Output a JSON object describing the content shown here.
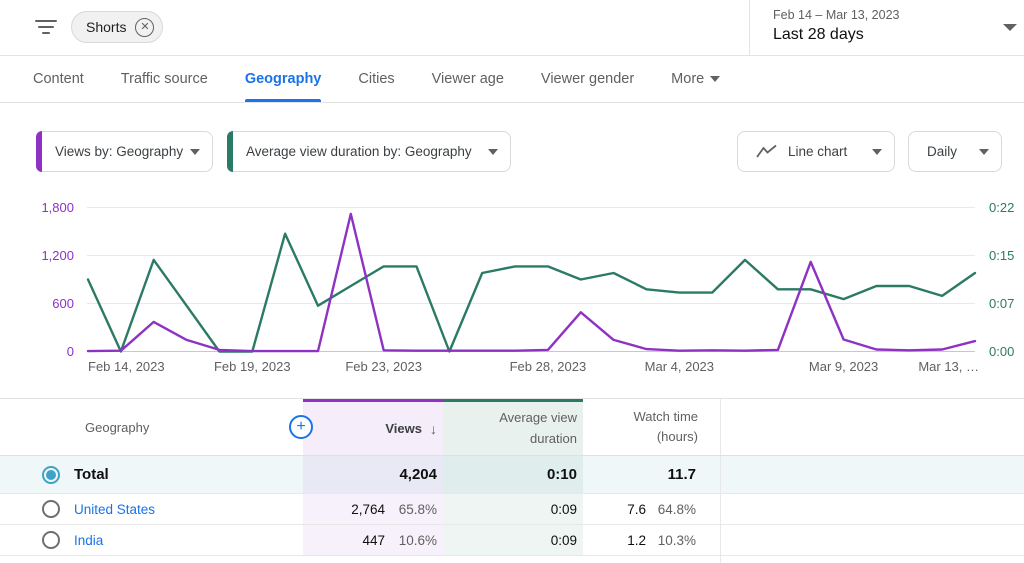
{
  "header": {
    "chip_label": "Shorts",
    "date_range": "Feb 14 – Mar 13, 2023",
    "date_preset": "Last 28 days"
  },
  "tabs": [
    {
      "label": "Content"
    },
    {
      "label": "Traffic source"
    },
    {
      "label": "Geography",
      "active": true
    },
    {
      "label": "Cities"
    },
    {
      "label": "Viewer age"
    },
    {
      "label": "Viewer gender"
    },
    {
      "label": "More"
    }
  ],
  "controls": {
    "metric1": "Views by: Geography",
    "metric2": "Average view duration by: Geography",
    "chart_type": "Line chart",
    "granularity": "Daily"
  },
  "chart_data": {
    "type": "line",
    "x": [
      "Feb 14",
      "Feb 15",
      "Feb 16",
      "Feb 17",
      "Feb 18",
      "Feb 19",
      "Feb 20",
      "Feb 21",
      "Feb 22",
      "Feb 23",
      "Feb 24",
      "Feb 25",
      "Feb 26",
      "Feb 27",
      "Feb 28",
      "Mar 1",
      "Mar 2",
      "Mar 3",
      "Mar 4",
      "Mar 5",
      "Mar 6",
      "Mar 7",
      "Mar 8",
      "Mar 9",
      "Mar 10",
      "Mar 11",
      "Mar 12",
      "Mar 13"
    ],
    "series": [
      {
        "name": "Views",
        "axis": "left",
        "color": "#8e32c4",
        "values": [
          5,
          10,
          370,
          145,
          20,
          5,
          5,
          5,
          1720,
          15,
          10,
          10,
          10,
          10,
          20,
          490,
          145,
          30,
          10,
          15,
          10,
          20,
          1120,
          150,
          25,
          15,
          25,
          130
        ]
      },
      {
        "name": "Average view duration (seconds)",
        "axis": "right",
        "color": "#2b7a66",
        "values": [
          11,
          0,
          14,
          7,
          0,
          0,
          18,
          7,
          10,
          13,
          13,
          0,
          12,
          13,
          13,
          11,
          12,
          9.5,
          9,
          9,
          14,
          9.5,
          9.5,
          8,
          10,
          10,
          8.5,
          12
        ]
      }
    ],
    "axes": {
      "left": {
        "title": "Views",
        "labels": [
          "0",
          "600",
          "1,200",
          "1,800"
        ],
        "max": 1800,
        "color": "#8e32c4"
      },
      "right": {
        "title": "Average view duration",
        "labels": [
          "0:00",
          "0:07",
          "0:15",
          "0:22"
        ],
        "max_seconds": 22,
        "color": "#2b7a66"
      }
    },
    "x_ticks": [
      {
        "day": 0,
        "label": "Feb 14, 2023"
      },
      {
        "day": 5,
        "label": "Feb 19, 2023"
      },
      {
        "day": 9,
        "label": "Feb 23, 2023"
      },
      {
        "day": 14,
        "label": "Feb 28, 2023"
      },
      {
        "day": 18,
        "label": "Mar 4, 2023"
      },
      {
        "day": 23,
        "label": "Mar 9, 2023"
      },
      {
        "day": 27,
        "label": "Mar 13, …"
      }
    ],
    "grid": true,
    "legend": false
  },
  "table": {
    "columns": [
      "Geography",
      "Views",
      "Average view duration",
      "Watch time (hours)"
    ],
    "sort": {
      "column": "Views",
      "direction": "desc",
      "arrow": "↓"
    },
    "total": {
      "label": "Total",
      "views": "4,204",
      "avg_duration": "0:10",
      "watch_hours": "11.7"
    },
    "rows": [
      {
        "name": "United States",
        "views": "2,764",
        "views_pct": "65.8%",
        "avg_duration": "0:09",
        "watch_hours": "7.6",
        "watch_pct": "64.8%"
      },
      {
        "name": "India",
        "views": "447",
        "views_pct": "10.6%",
        "avg_duration": "0:09",
        "watch_hours": "1.2",
        "watch_pct": "10.3%"
      }
    ]
  }
}
